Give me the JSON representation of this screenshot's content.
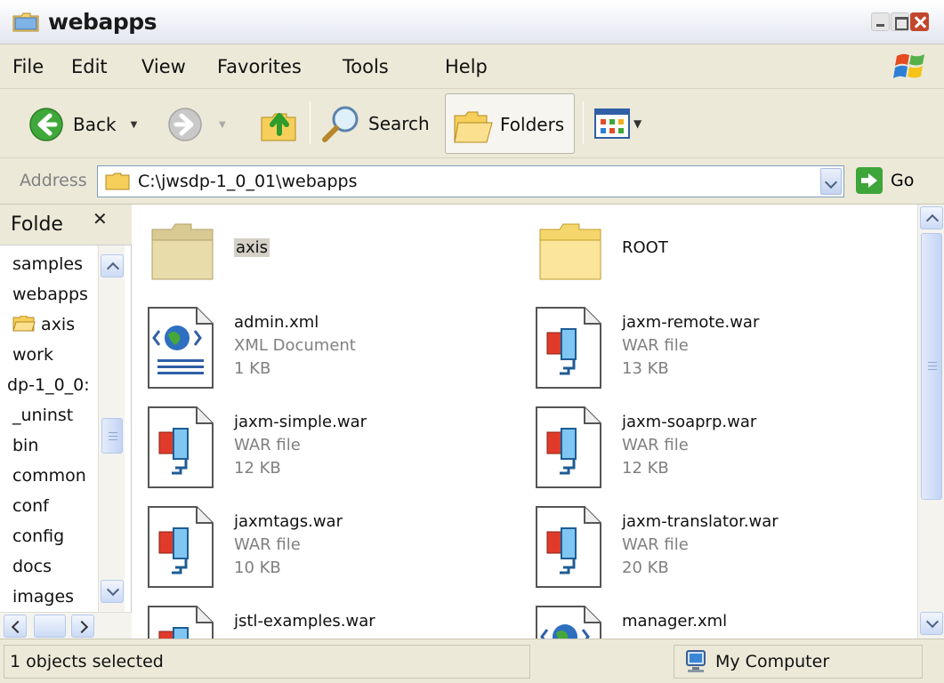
{
  "window": {
    "title": "webapps"
  },
  "menu": [
    "File",
    "Edit",
    "View",
    "Favorites",
    "Tools",
    "Help"
  ],
  "toolbar": {
    "back_label": "Back",
    "search_label": "Search",
    "folders_label": "Folders"
  },
  "address": {
    "label": "Address",
    "value": "C:\\jwsdp-1_0_01\\webapps",
    "go_label": "Go"
  },
  "folders_pane": {
    "title": "Folde",
    "items": [
      "samples",
      "webapps",
      "axis",
      "work",
      "dp-1_0_0:",
      "_uninst",
      "bin",
      "common",
      "conf",
      "config",
      "docs",
      "images"
    ]
  },
  "files": [
    {
      "name": "axis",
      "type": "",
      "size": "",
      "icon": "folder-icon"
    },
    {
      "name": "ROOT",
      "type": "",
      "size": "",
      "icon": "folder-icon"
    },
    {
      "name": "admin.xml",
      "type": "XML Document",
      "size": "1 KB",
      "icon": "xml-document-icon"
    },
    {
      "name": "jaxm-remote.war",
      "type": "WAR file",
      "size": "13 KB",
      "icon": "war-file-icon"
    },
    {
      "name": "jaxm-simple.war",
      "type": "WAR file",
      "size": "12 KB",
      "icon": "war-file-icon"
    },
    {
      "name": "jaxm-soaprp.war",
      "type": "WAR file",
      "size": "12 KB",
      "icon": "war-file-icon"
    },
    {
      "name": "jaxmtags.war",
      "type": "WAR file",
      "size": "10 KB",
      "icon": "war-file-icon"
    },
    {
      "name": "jaxm-translator.war",
      "type": "WAR file",
      "size": "20 KB",
      "icon": "war-file-icon"
    },
    {
      "name": "jstl-examples.war",
      "type": "",
      "size": "",
      "icon": "war-file-icon"
    },
    {
      "name": "manager.xml",
      "type": "",
      "size": "",
      "icon": "xml-document-icon"
    }
  ],
  "status": {
    "left": "1 objects selected",
    "right": "My Computer"
  },
  "colors": {
    "window_bg": "#ece9d8",
    "close_button": "#c2462b",
    "go_green": "#3da53a"
  }
}
